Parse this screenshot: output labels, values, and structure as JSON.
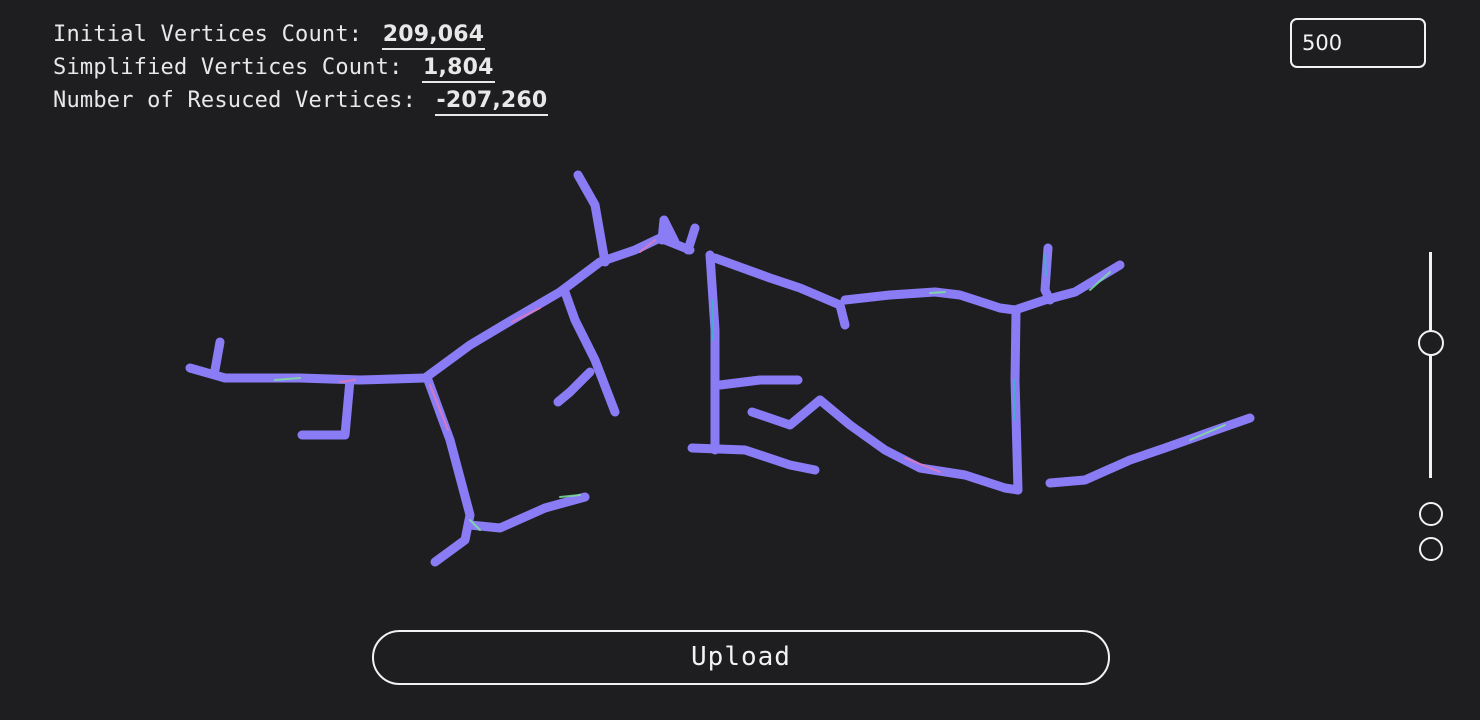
{
  "stats": {
    "initial_label": "Initial Vertices Count:",
    "initial_value": "209,064",
    "simplified_label": "Simplified Vertices Count:",
    "simplified_value": "1,804",
    "reduced_label": "Number of Resuced Vertices:",
    "reduced_value": "-207,260"
  },
  "ratio_input": {
    "value": "500"
  },
  "slider": {
    "level_fraction": 0.39
  },
  "upload": {
    "label": "Upload"
  },
  "viewport": {
    "mesh_colors": {
      "base": "#8a7cf5",
      "highlight_pink": "#e07ab8",
      "highlight_green": "#7ee0a0",
      "highlight_teal": "#3fb4c8"
    }
  }
}
